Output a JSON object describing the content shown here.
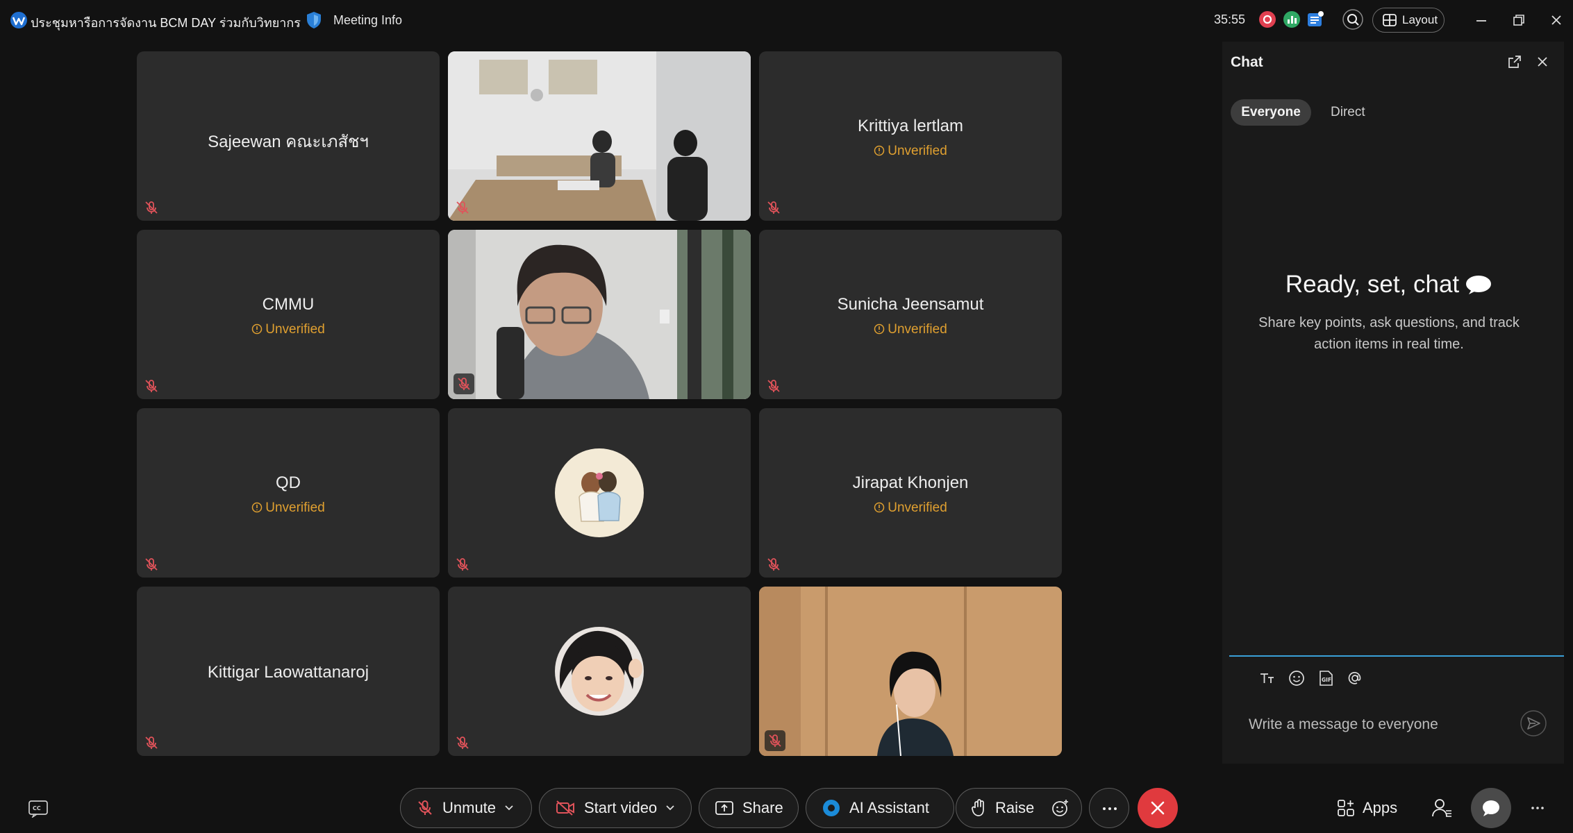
{
  "titlebar": {
    "meeting_title": "ประชุมหารือการจัดงาน BCM DAY ร่วมกับวิทยากร",
    "meeting_info": "Meeting Info",
    "timer": "35:55",
    "layout_label": "Layout"
  },
  "tiles": [
    {
      "name": "Sajeewan คณะเภสัชฯ",
      "status": ""
    },
    {
      "name": "",
      "status": "",
      "video": true
    },
    {
      "name": "Krittiya lertlam",
      "status": "Unverified"
    },
    {
      "name": "CMMU",
      "status": "Unverified"
    },
    {
      "name": "",
      "status": "",
      "video": true
    },
    {
      "name": "Sunicha Jeensamut",
      "status": "Unverified"
    },
    {
      "name": "QD",
      "status": "Unverified"
    },
    {
      "name": "",
      "status": "",
      "avatar": true
    },
    {
      "name": "Jirapat Khonjen",
      "status": "Unverified"
    },
    {
      "name": "Kittigar Laowattanaroj",
      "status": ""
    },
    {
      "name": "",
      "status": "",
      "avatar": true
    },
    {
      "name": "",
      "status": "",
      "video": true
    }
  ],
  "chat": {
    "title": "Chat",
    "tab_everyone": "Everyone",
    "tab_direct": "Direct",
    "empty_title": "Ready, set, chat",
    "empty_desc": "Share key points, ask questions, and track action items in real time.",
    "input_placeholder": "Write a message to everyone"
  },
  "controls": {
    "unmute": "Unmute",
    "start_video": "Start video",
    "share": "Share",
    "ai_assistant": "AI Assistant",
    "raise": "Raise",
    "more": "···",
    "apps": "Apps"
  },
  "colors": {
    "accent_blue": "#3aa0d8",
    "end_red": "#e03a3e",
    "unverified_orange": "#e0a030",
    "mute_red": "#e0535a"
  }
}
